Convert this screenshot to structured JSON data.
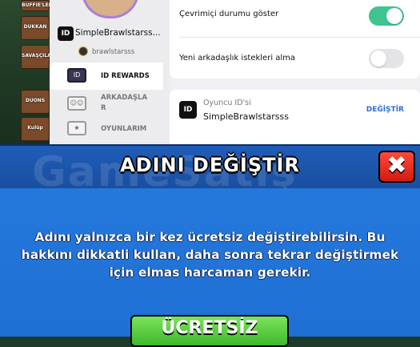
{
  "game": {
    "tiles": [
      "BUFFIE'LER",
      "DUKKAN",
      "SAVAŞÇILAR",
      "DUONS",
      "Kulüp"
    ]
  },
  "profile": {
    "id_badge": "ID",
    "username": "SimpleBrawlstarss...",
    "handle": "brawlstarsss"
  },
  "nav": {
    "items": [
      {
        "label": "ID REWARDS",
        "icon": "id-card-icon",
        "active": true
      },
      {
        "label": "ARKADAŞLA\nR",
        "icon": "friends-icon",
        "active": false
      },
      {
        "label": "OYUNLARIM",
        "icon": "games-icon",
        "active": false
      }
    ]
  },
  "settings": {
    "online_status_label": "Çevrimiçi durumu göster",
    "online_status_on": true,
    "friend_requests_label": "Yeni arkadaşlık istekleri alma",
    "friend_requests_on": false
  },
  "player_id": {
    "label": "Oyuncu ID'si",
    "value": "SimpleBrawlstarsss",
    "change_link": "DEĞİŞTİR",
    "badge": "ID"
  },
  "dialog": {
    "title": "ADINI DEĞİŞTİR",
    "close_glyph": "✖",
    "message": "Adını yalnızca bir kez ücretsiz değiştirebilirsin. Bu hakkını dikkatli kullan, daha sonra tekrar değiştirmek için elmas harcaman gerekir.",
    "free_button": "ÜCRETSİZ"
  },
  "watermark": "GameSatış",
  "colors": {
    "toggle_on": "#3ec48e",
    "accent_blue": "#1f6fd4",
    "close_red": "#d01b12",
    "free_green": "#3fb82d"
  }
}
